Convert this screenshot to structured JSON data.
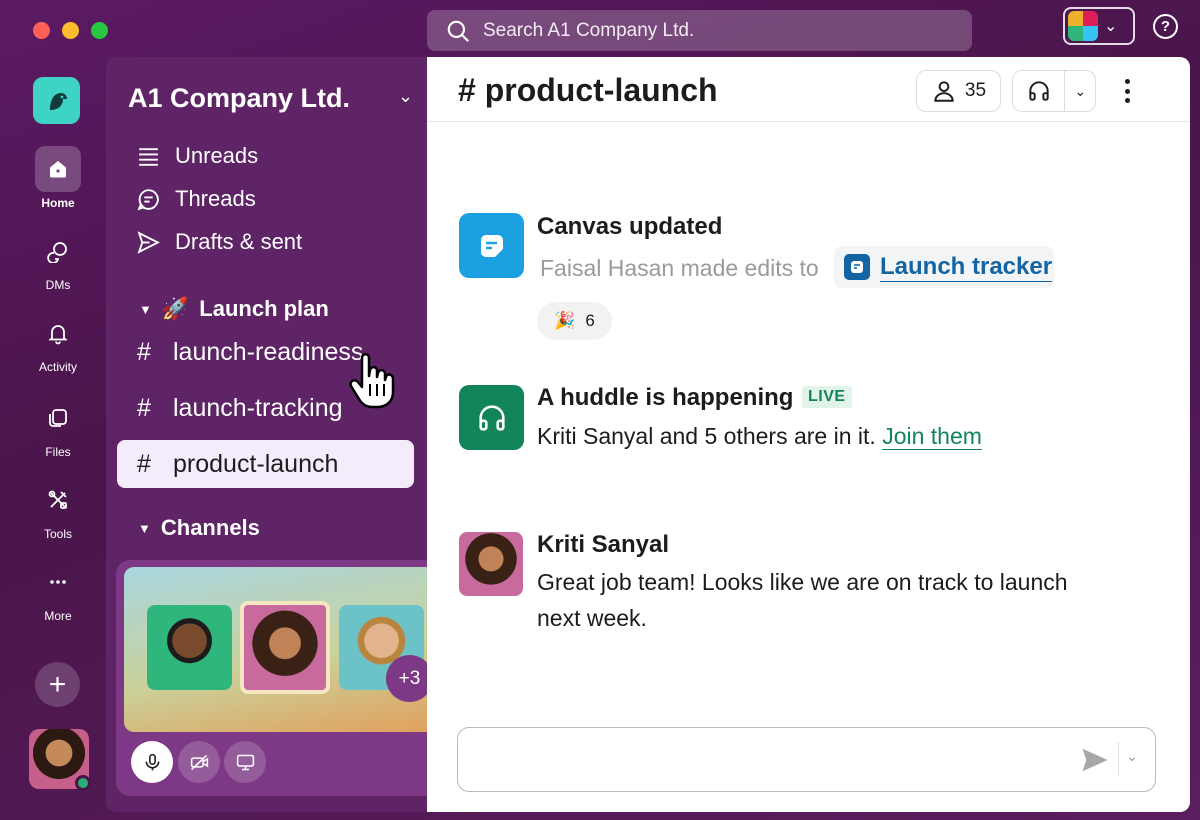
{
  "search": {
    "placeholder": "Search A1 Company Ltd."
  },
  "help": {
    "label": "?"
  },
  "rail": {
    "items": [
      {
        "label": "Home",
        "icon": "home-icon",
        "active": true
      },
      {
        "label": "DMs",
        "icon": "dms-icon"
      },
      {
        "label": "Activity",
        "icon": "bell-icon"
      },
      {
        "label": "Files",
        "icon": "files-icon"
      },
      {
        "label": "Tools",
        "icon": "tools-icon"
      },
      {
        "label": "More",
        "icon": "more-icon"
      }
    ],
    "add_label": "+"
  },
  "workspace": {
    "name": "A1 Company Ltd."
  },
  "sidebar": {
    "nav": [
      {
        "label": "Unreads",
        "icon": "unreads-icon"
      },
      {
        "label": "Threads",
        "icon": "threads-icon"
      },
      {
        "label": "Drafts & sent",
        "icon": "send-icon"
      }
    ],
    "sections": [
      {
        "label": "Launch plan",
        "emoji": "🚀"
      },
      {
        "label": "Channels"
      }
    ],
    "channels": [
      {
        "hash": "#",
        "label": "launch-readiness"
      },
      {
        "hash": "#",
        "label": "launch-tracking"
      },
      {
        "hash": "#",
        "label": "product-launch",
        "active": true
      }
    ]
  },
  "huddle_card": {
    "more_count": "+3"
  },
  "channel": {
    "title": "# product-launch",
    "member_count": "35"
  },
  "messages": {
    "canvas": {
      "title": "Canvas updated",
      "text": "Faisal Hasan made edits to",
      "link": "Launch tracker",
      "reaction_emoji": "🎉",
      "reaction_count": "6"
    },
    "huddle": {
      "title": "A huddle is happening",
      "badge": "LIVE",
      "text": "Kriti Sanyal and 5 others are in it.",
      "link": "Join them"
    },
    "kriti": {
      "name": "Kriti Sanyal",
      "line1": "Great job team! Looks like we are on track to launch",
      "line2": "next week."
    }
  },
  "colors": {
    "aubergine": "#4a154b",
    "sidebar": "#5e2465",
    "active_channel_bg": "#f4ecfa",
    "link_blue": "#1264a3",
    "huddle_green": "#12845a",
    "canvas_blue": "#1ba1e2"
  }
}
